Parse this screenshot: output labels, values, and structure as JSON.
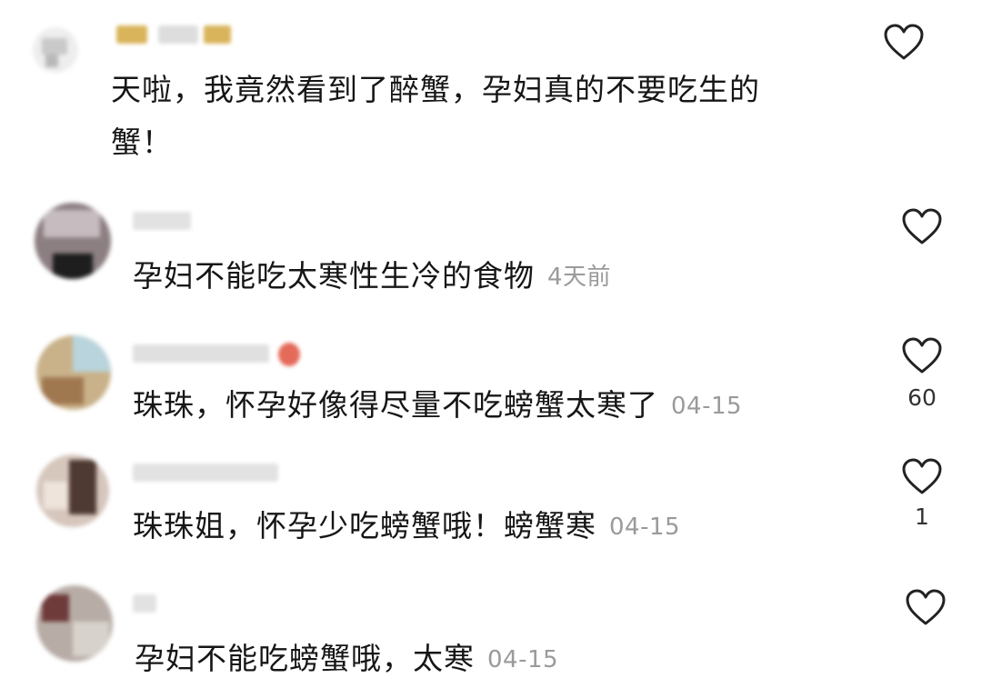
{
  "comments": [
    {
      "text_line1": "天啦，我竟然看到了醉蟹，孕妇真的不要吃生的",
      "text_line2": "蟹！",
      "time": "",
      "likes": ""
    },
    {
      "text": "孕妇不能吃太寒性生冷的食物",
      "time": "4天前",
      "likes": ""
    },
    {
      "text": "珠珠，怀孕好像得尽量不吃螃蟹太寒了",
      "time": "04-15",
      "likes": "60"
    },
    {
      "text": "珠珠姐，怀孕少吃螃蟹哦！螃蟹寒",
      "time": "04-15",
      "likes": "1"
    },
    {
      "text": "孕妇不能吃螃蟹哦，太寒",
      "time": "04-15",
      "likes": ""
    }
  ],
  "icons": {
    "like": "heart-outline-icon"
  },
  "colors": {
    "text": "#161616",
    "timestamp": "#9a9a9a",
    "icon_stroke": "#222222"
  }
}
